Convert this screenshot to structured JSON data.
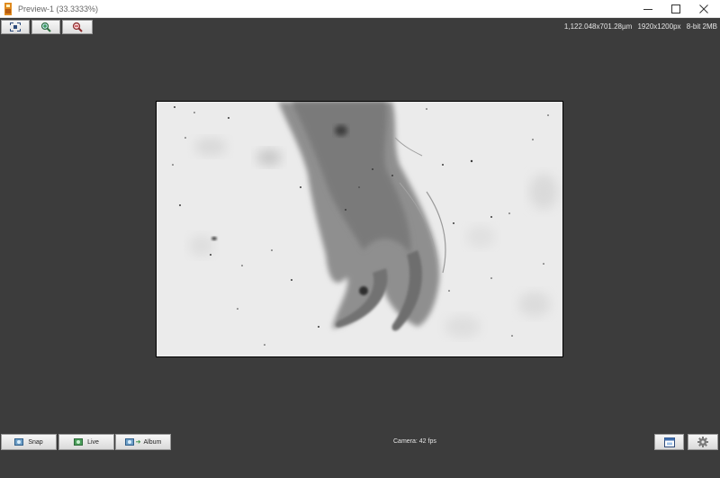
{
  "window": {
    "title": "Preview-1 (33.3333%)",
    "controls": [
      "minimize-icon",
      "maximize-icon",
      "close-icon"
    ]
  },
  "toolbar": {
    "buttons": [
      "fit-to-window-icon",
      "zoom-in-icon",
      "zoom-out-icon"
    ]
  },
  "image_info": {
    "physical_size": "1,122.048x701.28µm",
    "pixel_size": "1920x1200px",
    "format": "8-bit 2MB"
  },
  "preview": {
    "description_icon": "microscope-preview-image"
  },
  "bottom_bar": {
    "snap_label": "Snap",
    "live_label": "Live",
    "album_label": "Album",
    "status": "Camera: 42 fps",
    "icons": [
      "snap-camera-icon",
      "live-camera-icon",
      "album-icon",
      "save-window-icon",
      "settings-gear-icon"
    ]
  },
  "colors": {
    "background": "#3c3c3c",
    "titlebar": "#ffffff",
    "button_face": "#e8e8e8",
    "image_bg": "#ececec"
  }
}
